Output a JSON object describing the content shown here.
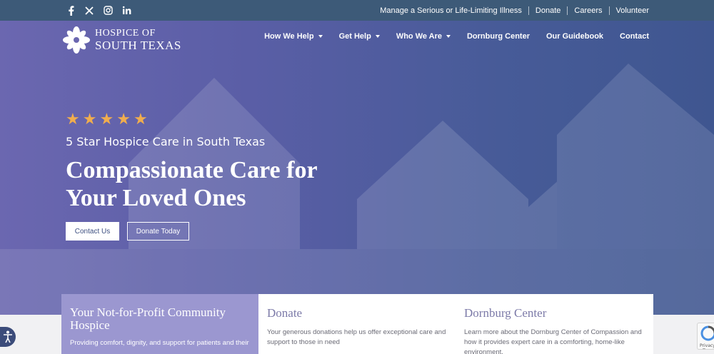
{
  "topbar": {
    "social": [
      {
        "icon": "facebook-icon",
        "glyph": "f"
      },
      {
        "icon": "x-icon",
        "glyph": "𝕏"
      },
      {
        "icon": "instagram-icon",
        "glyph": "◎"
      },
      {
        "icon": "linkedin-icon",
        "glyph": "in"
      }
    ],
    "links": [
      "Manage a Serious or Life-Limiting Illness",
      "Donate",
      "Careers",
      "Volunteer"
    ]
  },
  "logo": {
    "line1": "HOSPICE OF",
    "line2": "SOUTH TEXAS"
  },
  "nav": {
    "items": [
      {
        "label": "How We Help",
        "dropdown": true
      },
      {
        "label": "Get Help",
        "dropdown": true
      },
      {
        "label": "Who We Are",
        "dropdown": true
      },
      {
        "label": "Dornburg Center",
        "dropdown": false
      },
      {
        "label": "Our Guidebook",
        "dropdown": false
      },
      {
        "label": "Contact",
        "dropdown": false
      }
    ]
  },
  "hero": {
    "rating_stars": 5,
    "subhead": "5 Star Hospice Care in South Texas",
    "headline_line1": "Compassionate Care for",
    "headline_line2": "Your Loved Ones",
    "contact_label": "Contact Us",
    "donate_label": "Donate Today"
  },
  "cards": {
    "community": {
      "title": "Your Not-for-Profit Community Hospice",
      "text": "Providing comfort, dignity, and support for patients and their"
    },
    "donate": {
      "title": "Donate",
      "text": "Your generous donations help us offer exceptional care and support to those in need"
    },
    "dornburg": {
      "title": "Dornburg Center",
      "text": "Learn more about the Dornburg Center of Compassion and how it provides expert care in a comforting, home-like environment."
    }
  },
  "widgets": {
    "recaptcha_label": "Privacy - Terms"
  },
  "colors": {
    "topbar": "#3d5a78",
    "star": "#f0ad4e",
    "card_purple": "#9b97d0",
    "card_title": "#7c7aa8"
  }
}
